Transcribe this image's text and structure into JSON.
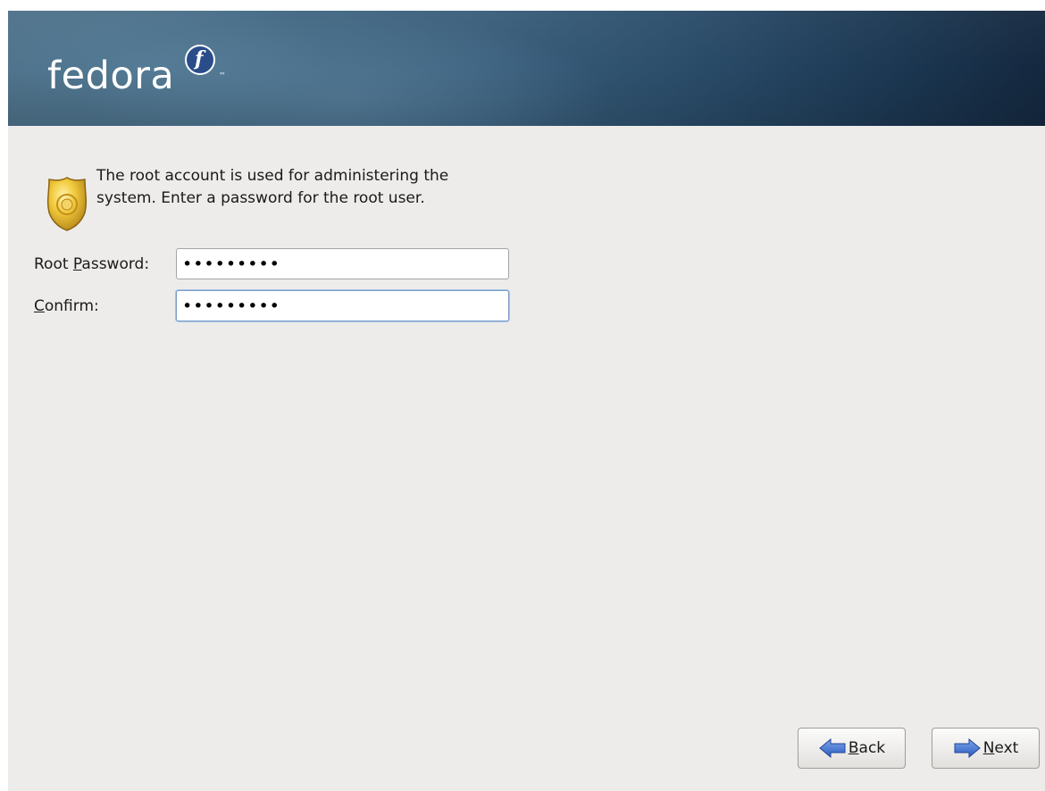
{
  "header": {
    "logo_text": "fedora",
    "logo_mark": "f",
    "logo_tm": "™"
  },
  "intro": {
    "icon": "security-badge-icon",
    "text": "The root account is used for administering the system.  Enter a password for the root user."
  },
  "form": {
    "root_password": {
      "label_prefix": "Root ",
      "label_mnemonic": "P",
      "label_rest": "assword:",
      "value": "•••••••••"
    },
    "confirm": {
      "label_mnemonic": "C",
      "label_rest": "onfirm:",
      "value": "•••••••••"
    }
  },
  "buttons": {
    "back": {
      "mnemonic": "B",
      "rest": "ack",
      "icon": "arrow-left-icon"
    },
    "next": {
      "mnemonic": "N",
      "rest": "ext",
      "icon": "arrow-right-icon"
    }
  },
  "colors": {
    "banner_left": "#4d7189",
    "banner_right": "#14283f",
    "background": "#edeceb",
    "arrow_blue": "#3c6fd1",
    "badge_gold": "#e2b52a"
  }
}
